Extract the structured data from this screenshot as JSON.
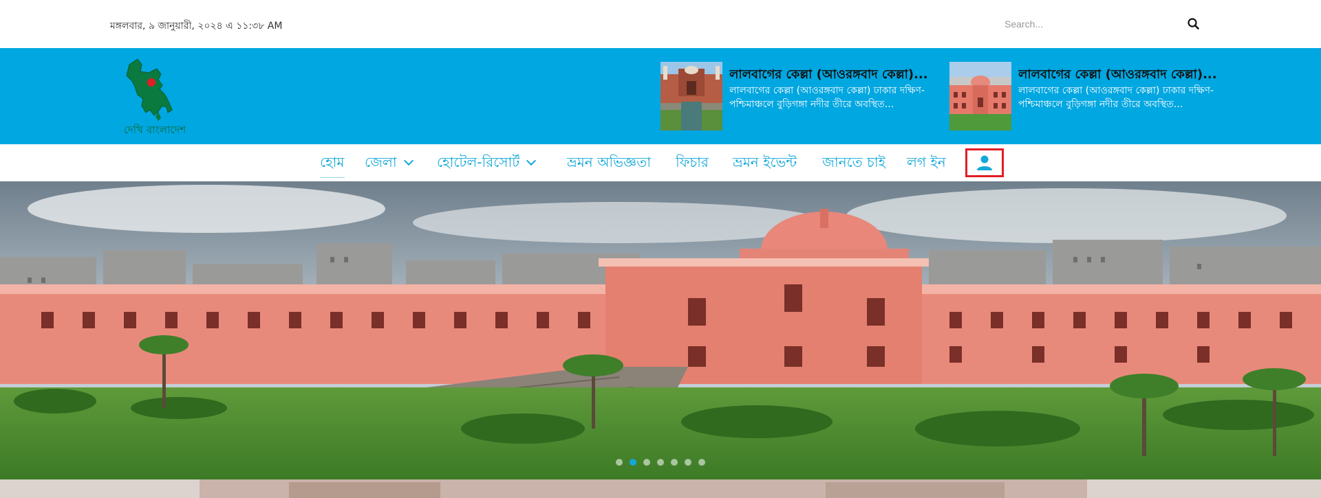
{
  "topbar": {
    "date_text": "মঙ্গলবার, ৯ জানুয়ারী, ২০২৪ এ ১১:৩৮ AM",
    "search_placeholder": "Search...",
    "search_icon": "search-icon"
  },
  "header": {
    "logo_text": "দেখি বাংলাদেশ",
    "posts": [
      {
        "title": "লালবাগের কেল্লা (আওরঙ্গবাদ কেল্লা)...",
        "excerpt": "লালবাগের কেল্লা (আওরঙ্গবাদ কেল্লা) ঢাকার দক্ষিণ-পশ্চিমাঞ্চলে বুড়িগঙ্গা নদীর তীরে অবস্থিত..."
      },
      {
        "title": "লালবাগের কেল্লা (আওরঙ্গবাদ কেল্লা)...",
        "excerpt": "লালবাগের কেল্লা (আওরঙ্গবাদ কেল্লা) ঢাকার দক্ষিণ-পশ্চিমাঞ্চলে বুড়িগঙ্গা নদীর তীরে অবস্থিত..."
      }
    ]
  },
  "nav": {
    "items": [
      {
        "label": "হোম",
        "active": true
      },
      {
        "label": "জেলা",
        "dropdown": true
      },
      {
        "label": "হোটেল-রিসোর্ট",
        "dropdown": true
      },
      {
        "label": "ভ্রমন অভিজ্ঞতা"
      },
      {
        "label": "ফিচার"
      },
      {
        "label": "ভ্রমন ইভেন্ট"
      },
      {
        "label": "জানতে চাই"
      },
      {
        "label": "লগ ইন"
      }
    ],
    "user_icon": "user-icon"
  },
  "slider": {
    "slide_count": 7,
    "active_index": 1
  },
  "colors": {
    "header_blue": "#00a7e1",
    "nav_text": "#13a8d8",
    "highlight_red": "#e21d26"
  }
}
